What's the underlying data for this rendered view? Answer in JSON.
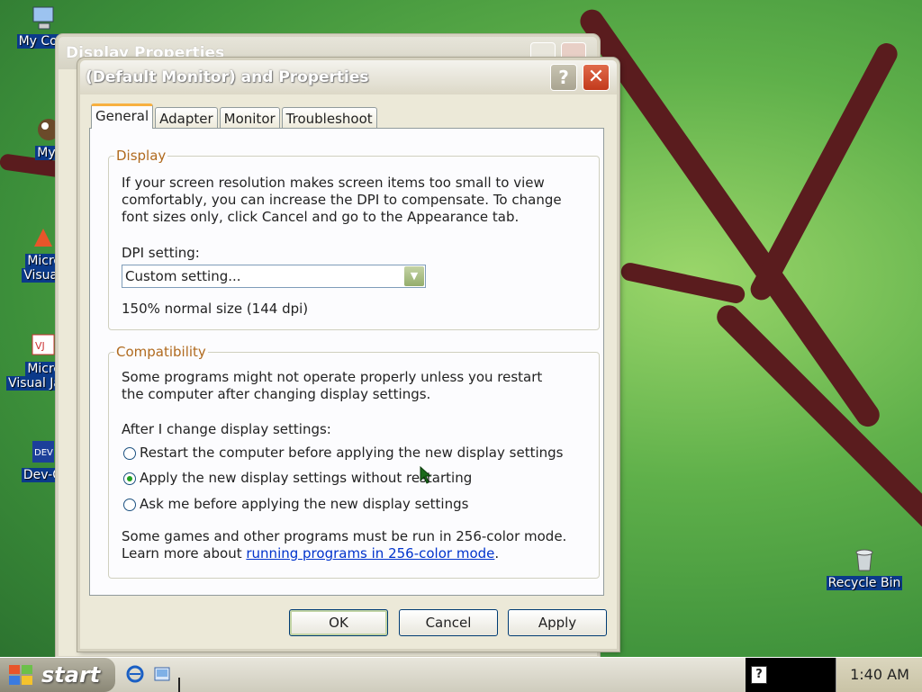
{
  "desktop": {
    "icons": [
      {
        "label": "My Com",
        "icon": "computer-icon"
      },
      {
        "label": "MyPa",
        "icon": "paint-icon"
      },
      {
        "label": "Micro",
        "label2": "Visual",
        "icon": "app-shortcut-icon"
      },
      {
        "label": "Micro",
        "label2": "Visual Ja",
        "icon": "java-shortcut-icon"
      },
      {
        "label": "Dev-C",
        "icon": "devc-shortcut-icon"
      },
      {
        "label": "Recycle Bin",
        "icon": "recycle-bin-icon"
      }
    ]
  },
  "background_window": {
    "title": "Display Properties"
  },
  "dialog": {
    "title": "(Default Monitor) and  Properties",
    "tabs": [
      "General",
      "Adapter",
      "Monitor",
      "Troubleshoot"
    ],
    "display_group": {
      "label": "Display",
      "description": "If your screen resolution makes screen items too small to view comfortably, you can increase the DPI to compensate.  To change font sizes only, click Cancel and go to the Appearance tab.",
      "dpi_label": "DPI setting:",
      "dpi_value": "Custom setting...",
      "dpi_info": "150% normal size (144 dpi)"
    },
    "compat_group": {
      "label": "Compatibility",
      "description": "Some programs might not operate properly unless you restart the computer after changing display settings.",
      "after_label": "After I change display settings:",
      "options": [
        "Restart the computer before applying the new display settings",
        "Apply the new display settings without restarting",
        "Ask me before applying the new display settings"
      ],
      "selected_option": 1,
      "games_line1": "Some games and other programs must be run in 256-color mode.",
      "learn_more_prefix": "Learn more about ",
      "learn_more_link": "running programs in 256-color mode",
      "learn_more_suffix": "."
    },
    "buttons": {
      "ok": "OK",
      "cancel": "Cancel",
      "apply": "Apply"
    }
  },
  "taskbar": {
    "start_label": "start",
    "clock": "1:40 AM"
  },
  "colors": {
    "group_label": "#b06a1e",
    "link": "#0033cc",
    "radio_checked": "#21a121"
  }
}
